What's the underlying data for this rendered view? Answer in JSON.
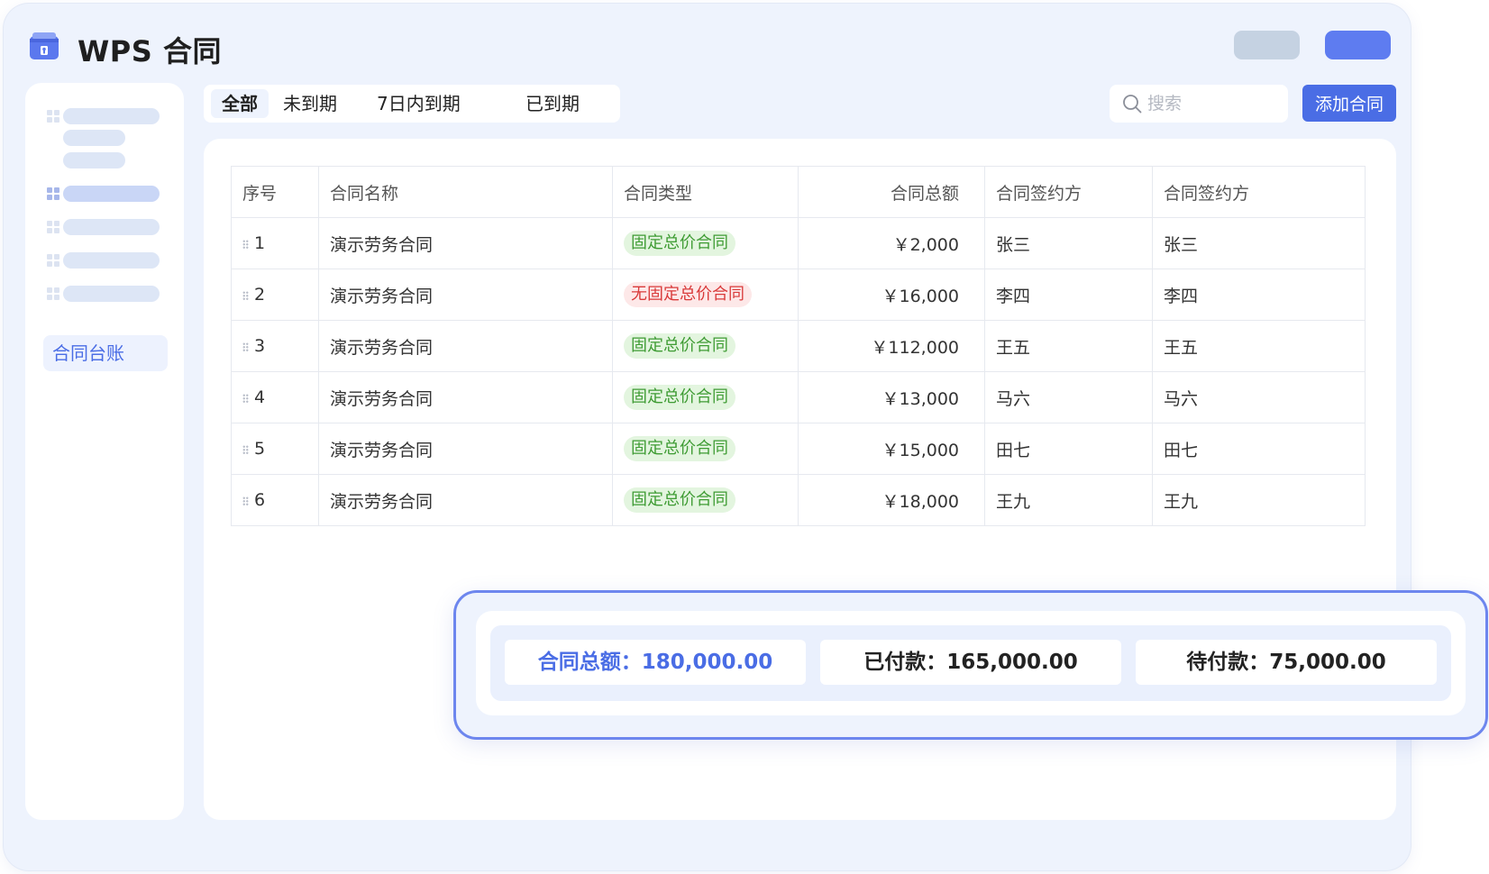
{
  "app": {
    "title": "WPS 合同"
  },
  "sidebar": {
    "active_item": "合同台账"
  },
  "tabs": [
    {
      "label": "全部",
      "active": true
    },
    {
      "label": "未到期"
    },
    {
      "label": "7日内到期"
    },
    {
      "label": "已到期"
    }
  ],
  "search": {
    "placeholder": "搜索",
    "value": ""
  },
  "toolbar": {
    "add_label": "添加合同"
  },
  "table": {
    "columns": [
      "序号",
      "合同名称",
      "合同类型",
      "合同总额",
      "合同签约方",
      "合同签约方"
    ],
    "rows": [
      {
        "no": "1",
        "name": "演示劳务合同",
        "type": "固定总价合同",
        "type_status": "green",
        "amount": "￥2,000",
        "party_a": "张三",
        "party_b": "张三"
      },
      {
        "no": "2",
        "name": "演示劳务合同",
        "type": "无固定总价合同",
        "type_status": "red",
        "amount": "￥16,000",
        "party_a": "李四",
        "party_b": "李四"
      },
      {
        "no": "3",
        "name": "演示劳务合同",
        "type": "固定总价合同",
        "type_status": "green",
        "amount": "￥112,000",
        "party_a": "王五",
        "party_b": "王五"
      },
      {
        "no": "4",
        "name": "演示劳务合同",
        "type": "固定总价合同",
        "type_status": "green",
        "amount": "￥13,000",
        "party_a": "马六",
        "party_b": "马六"
      },
      {
        "no": "5",
        "name": "演示劳务合同",
        "type": "固定总价合同",
        "type_status": "green",
        "amount": "￥15,000",
        "party_a": "田七",
        "party_b": "田七"
      },
      {
        "no": "6",
        "name": "演示劳务合同",
        "type": "固定总价合同",
        "type_status": "green",
        "amount": "￥18,000",
        "party_a": "王九",
        "party_b": "王九"
      }
    ]
  },
  "summary": {
    "total": "合同总额：180,000.00",
    "paid": "已付款：165,000.00",
    "pending": "待付款：75,000.00"
  },
  "colors": {
    "accent": "#4a6de5",
    "background": "#eef3fd",
    "tag_green_text": "#3f9c34",
    "tag_red_text": "#d93a3a"
  },
  "icons": {
    "logo": "contract-folder-icon",
    "search": "search-icon",
    "sidebar_item": "grid-dots-icon"
  }
}
